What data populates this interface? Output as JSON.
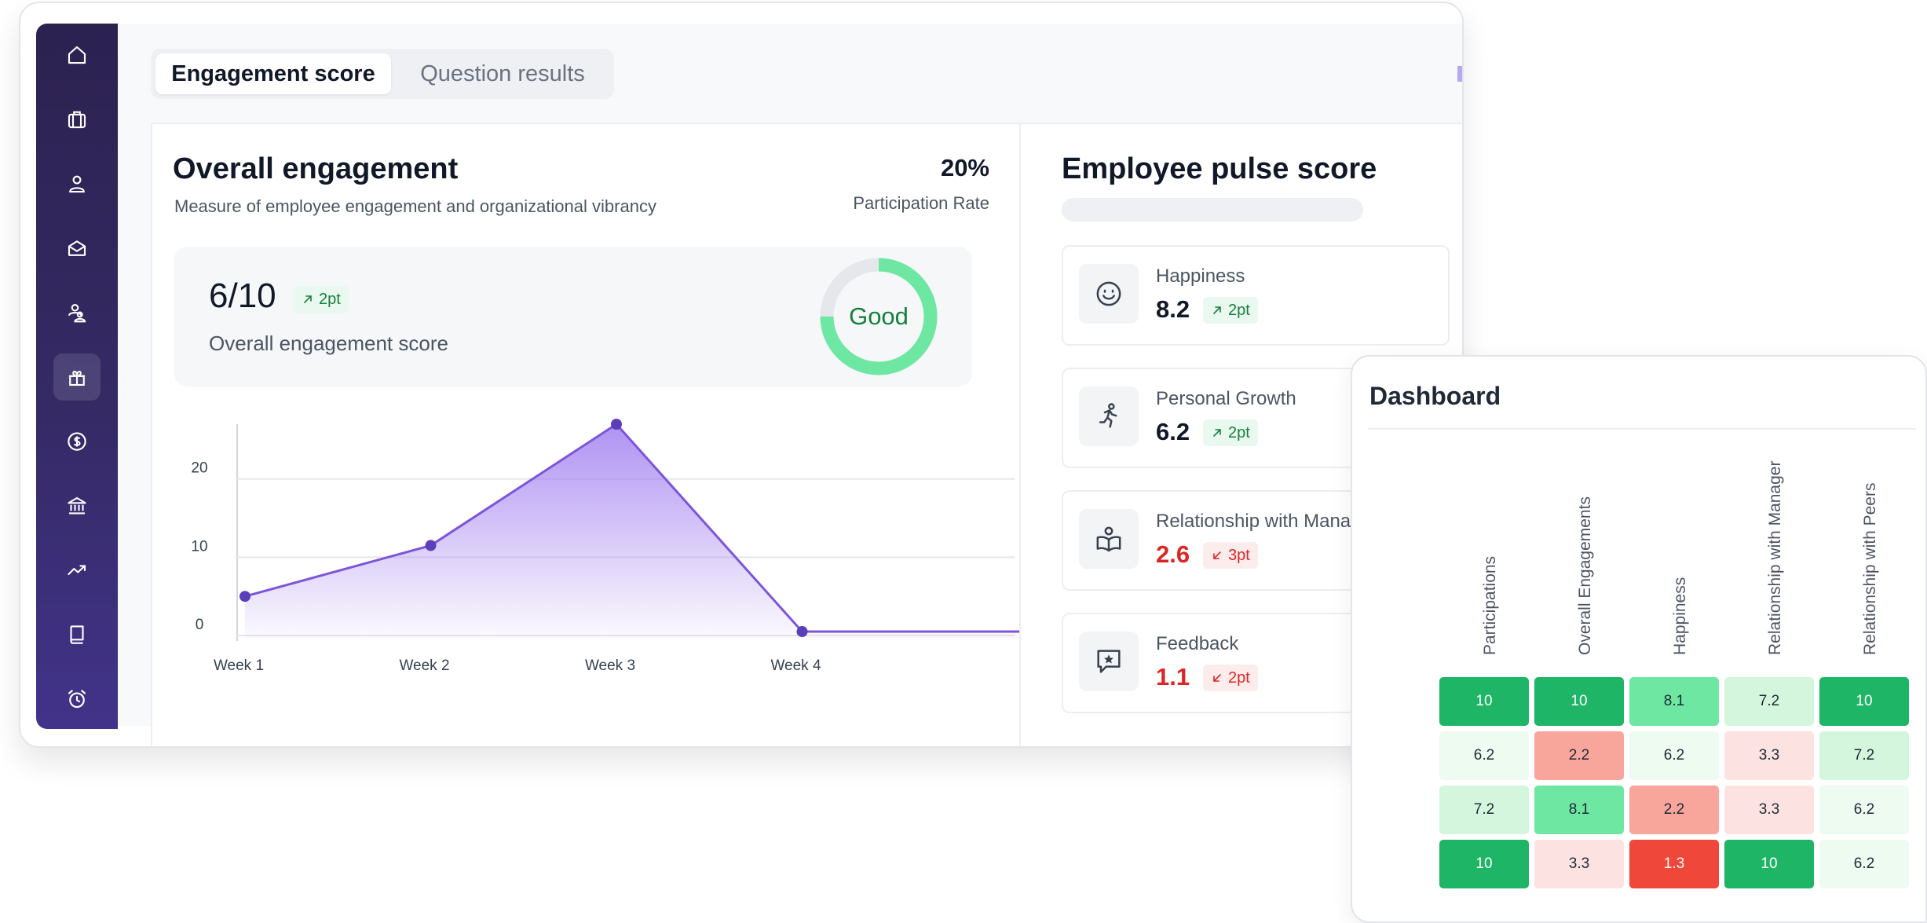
{
  "tabs": [
    {
      "label": "Engagement score",
      "active": true
    },
    {
      "label": "Question results",
      "active": false
    }
  ],
  "overall": {
    "title": "Overall engagement",
    "subtitle": "Measure of employee engagement and organizational vibrancy",
    "participation_value": "20%",
    "participation_label": "Participation Rate",
    "score": "6/10",
    "score_badge": "2pt",
    "score_label": "Overall engagement score",
    "rating_label": "Good",
    "rating_fraction": 0.75,
    "ring_color": "#6ee7a3"
  },
  "chart_data": {
    "type": "area",
    "categories": [
      "Week 1",
      "Week 2",
      "Week 3",
      "Week 4"
    ],
    "x": [
      1,
      2,
      3,
      4
    ],
    "values": [
      5,
      11.5,
      27,
      0.5
    ],
    "tail_value": 0.5,
    "y_ticks": [
      0,
      10,
      20
    ],
    "ylim": [
      -0.5,
      27
    ],
    "line_color": "#7c55d9",
    "title": "",
    "xlabel": "",
    "ylabel": ""
  },
  "pulse": {
    "title": "Employee pulse score",
    "cards": [
      {
        "label": "Happiness",
        "value": "8.2",
        "badge": "2pt",
        "trend": "up",
        "icon": "smile-icon"
      },
      {
        "label": "Personal Growth",
        "value": "6.2",
        "badge": "2pt",
        "trend": "up",
        "icon": "running-person-icon"
      },
      {
        "label": "Relationship with Manager",
        "value": "2.6",
        "badge": "3pt",
        "trend": "down",
        "icon": "open-book-person-icon"
      },
      {
        "label": "Feedback",
        "value": "1.1",
        "badge": "2pt",
        "trend": "down",
        "icon": "star-message-icon"
      }
    ]
  },
  "dashboard": {
    "title": "Dashboard",
    "columns": [
      "Participations",
      "Overall Engagements",
      "Happiness",
      "Relationship with Manager",
      "Relationship with Peers"
    ],
    "rows": [
      [
        "10",
        "10",
        "8.1",
        "7.2",
        "10"
      ],
      [
        "6.2",
        "2.2",
        "6.2",
        "3.3",
        "7.2"
      ],
      [
        "7.2",
        "8.1",
        "2.2",
        "3.3",
        "6.2"
      ],
      [
        "10",
        "3.3",
        "1.3",
        "10",
        "6.2"
      ]
    ]
  },
  "sidebar": {
    "items": [
      "home-icon",
      "briefcase-icon",
      "user-icon",
      "mail-icon",
      "team-icon",
      "gift-icon",
      "dollar-icon",
      "bank-icon",
      "trending-up-icon",
      "book-icon",
      "alarm-clock-icon"
    ],
    "active_index": 5
  },
  "colors": {
    "up": "#15803d",
    "down": "#dc2626",
    "heat_scale": {
      "dark_green": "#1eb566",
      "mid_green": "#6ee7a3",
      "light_green": "#d4f6dd",
      "faint_green": "#eefbf1",
      "light_red": "#fde2e2",
      "mid_red": "#f8a59c",
      "red": "#f0473b"
    }
  }
}
